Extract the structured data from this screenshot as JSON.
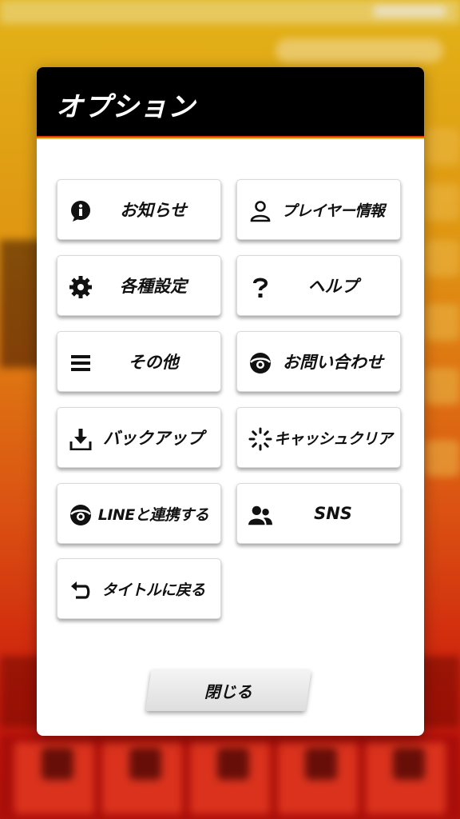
{
  "modal": {
    "title": "オプション",
    "close_label": "閉じる"
  },
  "buttons": [
    {
      "id": "news",
      "label": "お知らせ",
      "icon": "info-icon"
    },
    {
      "id": "player-info",
      "label": "プレイヤー情報",
      "icon": "person-icon"
    },
    {
      "id": "settings",
      "label": "各種設定",
      "icon": "gear-icon"
    },
    {
      "id": "help",
      "label": "ヘルプ",
      "icon": "question-icon"
    },
    {
      "id": "other",
      "label": "その他",
      "icon": "menu-icon"
    },
    {
      "id": "contact",
      "label": "お問い合わせ",
      "icon": "contact-icon"
    },
    {
      "id": "backup",
      "label": "バックアップ",
      "icon": "download-icon"
    },
    {
      "id": "clear-cache",
      "label": "キャッシュクリア",
      "icon": "spinner-icon"
    },
    {
      "id": "line-link",
      "label": "LINEと連携する",
      "icon": "link-icon"
    },
    {
      "id": "sns",
      "label": "SNS",
      "icon": "people-icon"
    },
    {
      "id": "back-to-title",
      "label": "タイトルに戻る",
      "icon": "return-icon"
    }
  ]
}
